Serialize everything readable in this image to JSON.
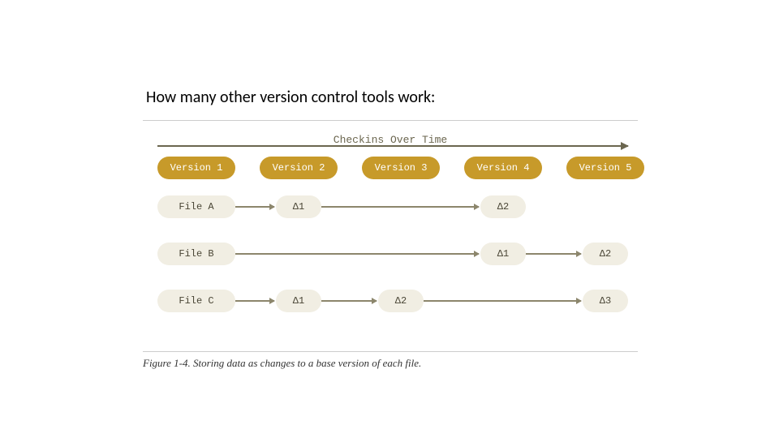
{
  "title": "How many other version control tools work:",
  "timeline_label": "Checkins Over Time",
  "versions": [
    "Version 1",
    "Version 2",
    "Version 3",
    "Version 4",
    "Version 5"
  ],
  "files": {
    "A": {
      "label": "File A",
      "deltas": {
        "col2": "Δ1",
        "col4": "Δ2"
      }
    },
    "B": {
      "label": "File B",
      "deltas": {
        "col4": "Δ1",
        "col5": "Δ2"
      }
    },
    "C": {
      "label": "File C",
      "deltas": {
        "col2": "Δ1",
        "col3": "Δ2",
        "col5": "Δ3"
      }
    }
  },
  "caption": "Figure 1-4. Storing data as changes to a base version of each file."
}
